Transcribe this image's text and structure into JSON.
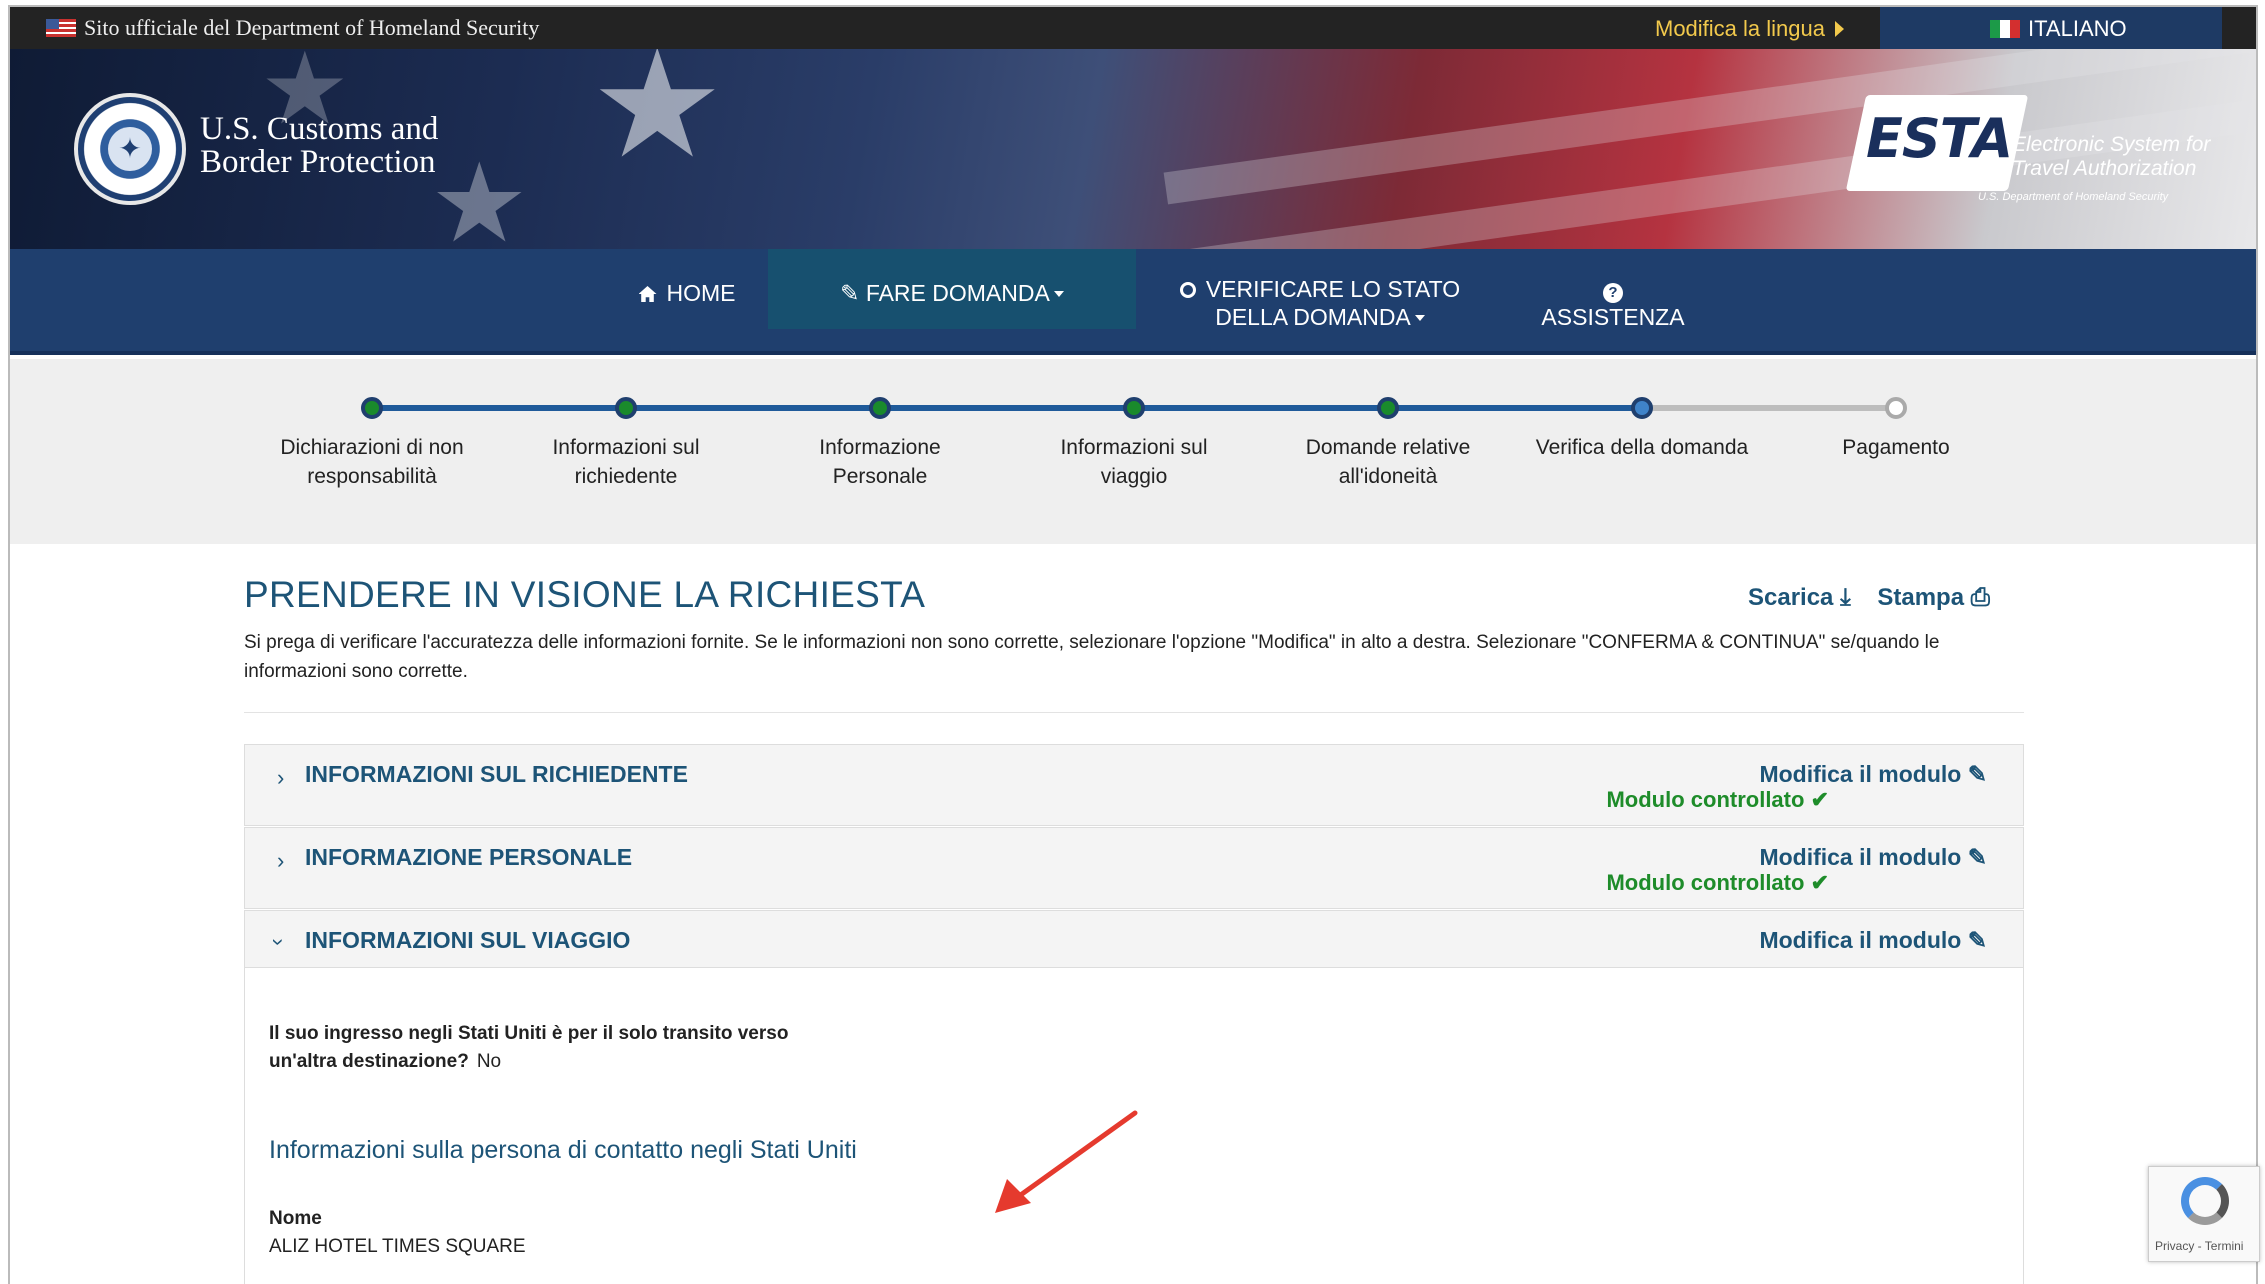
{
  "topbar": {
    "official": "Sito ufficiale del Department of Homeland Security",
    "change_language": "Modifica la lingua",
    "language": "ITALIANO"
  },
  "header": {
    "agency": "U.S. Customs and Border Protection",
    "agency_line1": "U.S. Customs and",
    "agency_line2": "Border Protection",
    "esta_logo": "ESTA",
    "esta_tagline_1": "Electronic System for",
    "esta_tagline_2": "Travel Authorization",
    "esta_sub": "U.S. Department of Homeland Security"
  },
  "nav": {
    "home": "HOME",
    "apply": "FARE DOMANDA",
    "status_1": "VERIFICARE LO STATO",
    "status_2": "DELLA DOMANDA",
    "help": "ASSISTENZA"
  },
  "progress": {
    "steps": [
      {
        "line1": "Dichiarazioni di non",
        "line2": "responsabilità",
        "state": "done"
      },
      {
        "line1": "Informazioni sul",
        "line2": "richiedente",
        "state": "done"
      },
      {
        "line1": "Informazione",
        "line2": "Personale",
        "state": "done"
      },
      {
        "line1": "Informazioni sul",
        "line2": "viaggio",
        "state": "done"
      },
      {
        "line1": "Domande relative",
        "line2": "all'idoneità",
        "state": "done"
      },
      {
        "line1": "Verifica della domanda",
        "line2": "",
        "state": "current"
      },
      {
        "line1": "Pagamento",
        "line2": "",
        "state": "todo"
      }
    ]
  },
  "main": {
    "title": "PRENDERE IN VISIONE LA RICHIESTA",
    "download": "Scarica",
    "print": "Stampa",
    "intro": "Si prega di verificare l'accuratezza delle informazioni fornite. Se le informazioni non sono corrette, selezionare l'opzione \"Modifica\" in alto a destra. Selezionare \"CONFERMA & CONTINUA\" se/quando le informazioni sono corrette."
  },
  "panels": [
    {
      "title": "INFORMAZIONI SUL RICHIEDENTE",
      "edit": "Modifica il modulo",
      "checked": "Modulo controllato",
      "expanded": false
    },
    {
      "title": "INFORMAZIONE PERSONALE",
      "edit": "Modifica il modulo",
      "checked": "Modulo controllato",
      "expanded": false
    },
    {
      "title": "INFORMAZIONI SUL VIAGGIO",
      "edit": "Modifica il modulo",
      "expanded": true
    }
  ],
  "travel": {
    "transit_question": "Il suo ingresso negli Stati Uniti è per il solo transito verso un'altra destinazione?",
    "transit_answer": "No",
    "contact_heading": "Informazioni sulla persona di contatto negli Stati Uniti",
    "name_label": "Nome",
    "name_value": "ALIZ HOTEL TIMES SQUARE"
  },
  "recaptcha": {
    "text": "Privacy - Termini"
  },
  "colors": {
    "nav": "#1f3f6e",
    "accent_text": "#1d5477",
    "checked_green": "#1e8c2a",
    "annotation_arrow": "#e53a2e"
  }
}
